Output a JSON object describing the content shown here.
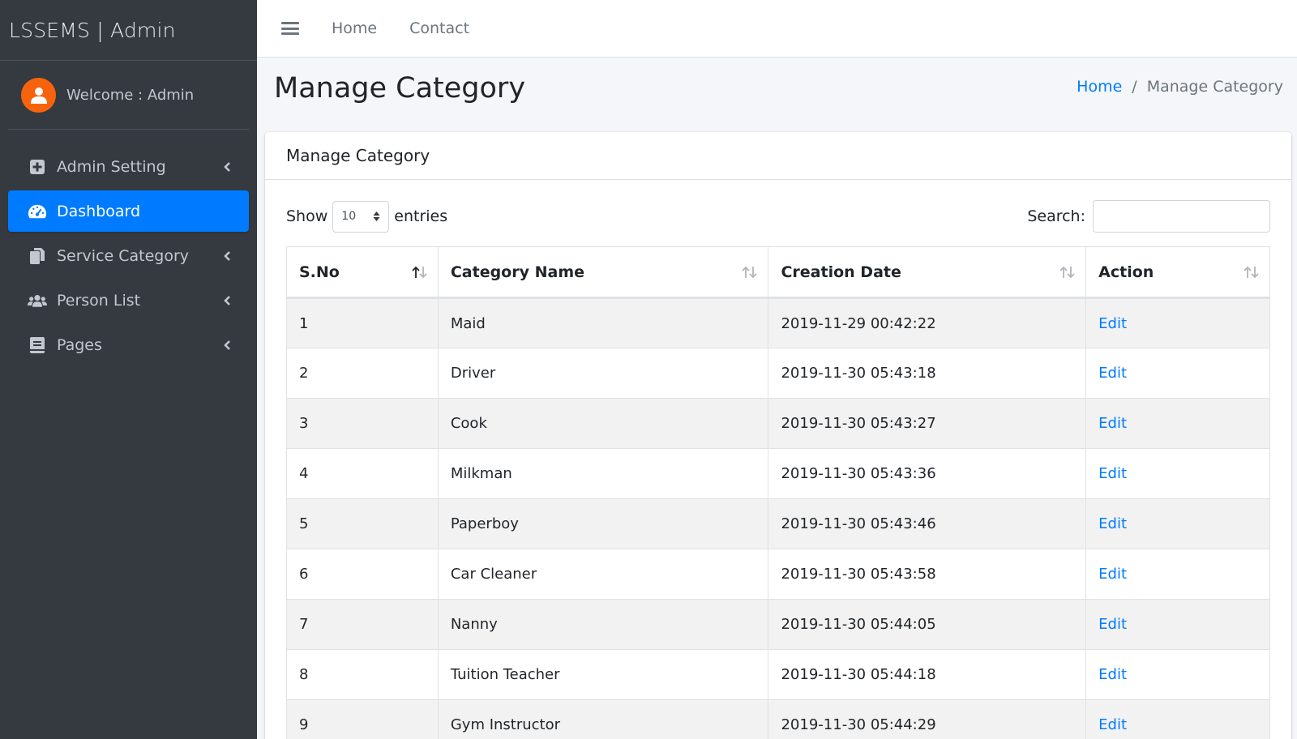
{
  "sidebar": {
    "brand": "LSSEMS | Admin",
    "welcome": "Welcome : Admin",
    "items": [
      {
        "label": "Admin Setting",
        "icon": "plus-square-icon",
        "active": false,
        "has_arrow": true
      },
      {
        "label": "Dashboard",
        "icon": "tachometer-icon",
        "active": true,
        "has_arrow": false
      },
      {
        "label": "Service Category",
        "icon": "copy-icon",
        "active": false,
        "has_arrow": true
      },
      {
        "label": "Person List",
        "icon": "users-icon",
        "active": false,
        "has_arrow": true
      },
      {
        "label": "Pages",
        "icon": "book-icon",
        "active": false,
        "has_arrow": true
      }
    ]
  },
  "topbar": {
    "links": [
      "Home",
      "Contact"
    ]
  },
  "header": {
    "title": "Manage Category",
    "breadcrumb": {
      "home": "Home",
      "separator": "/",
      "current": "Manage Category"
    }
  },
  "card": {
    "title": "Manage Category",
    "show_label": "Show",
    "entries_value": "10",
    "entries_label": "entries",
    "search_label": "Search:",
    "search_value": ""
  },
  "table": {
    "columns": [
      "S.No",
      "Category Name",
      "Creation Date",
      "Action"
    ],
    "rows": [
      {
        "sno": "1",
        "name": "Maid",
        "date": "2019-11-29 00:42:22",
        "action": "Edit"
      },
      {
        "sno": "2",
        "name": "Driver",
        "date": "2019-11-30 05:43:18",
        "action": "Edit"
      },
      {
        "sno": "3",
        "name": "Cook",
        "date": "2019-11-30 05:43:27",
        "action": "Edit"
      },
      {
        "sno": "4",
        "name": "Milkman",
        "date": "2019-11-30 05:43:36",
        "action": "Edit"
      },
      {
        "sno": "5",
        "name": "Paperboy",
        "date": "2019-11-30 05:43:46",
        "action": "Edit"
      },
      {
        "sno": "6",
        "name": "Car Cleaner",
        "date": "2019-11-30 05:43:58",
        "action": "Edit"
      },
      {
        "sno": "7",
        "name": "Nanny",
        "date": "2019-11-30 05:44:05",
        "action": "Edit"
      },
      {
        "sno": "8",
        "name": "Tuition Teacher",
        "date": "2019-11-30 05:44:18",
        "action": "Edit"
      },
      {
        "sno": "9",
        "name": "Gym Instructor",
        "date": "2019-11-30 05:44:29",
        "action": "Edit"
      }
    ]
  },
  "colors": {
    "sidebar_bg": "#343a40",
    "accent": "#007bff",
    "avatar": "#f7630c"
  }
}
